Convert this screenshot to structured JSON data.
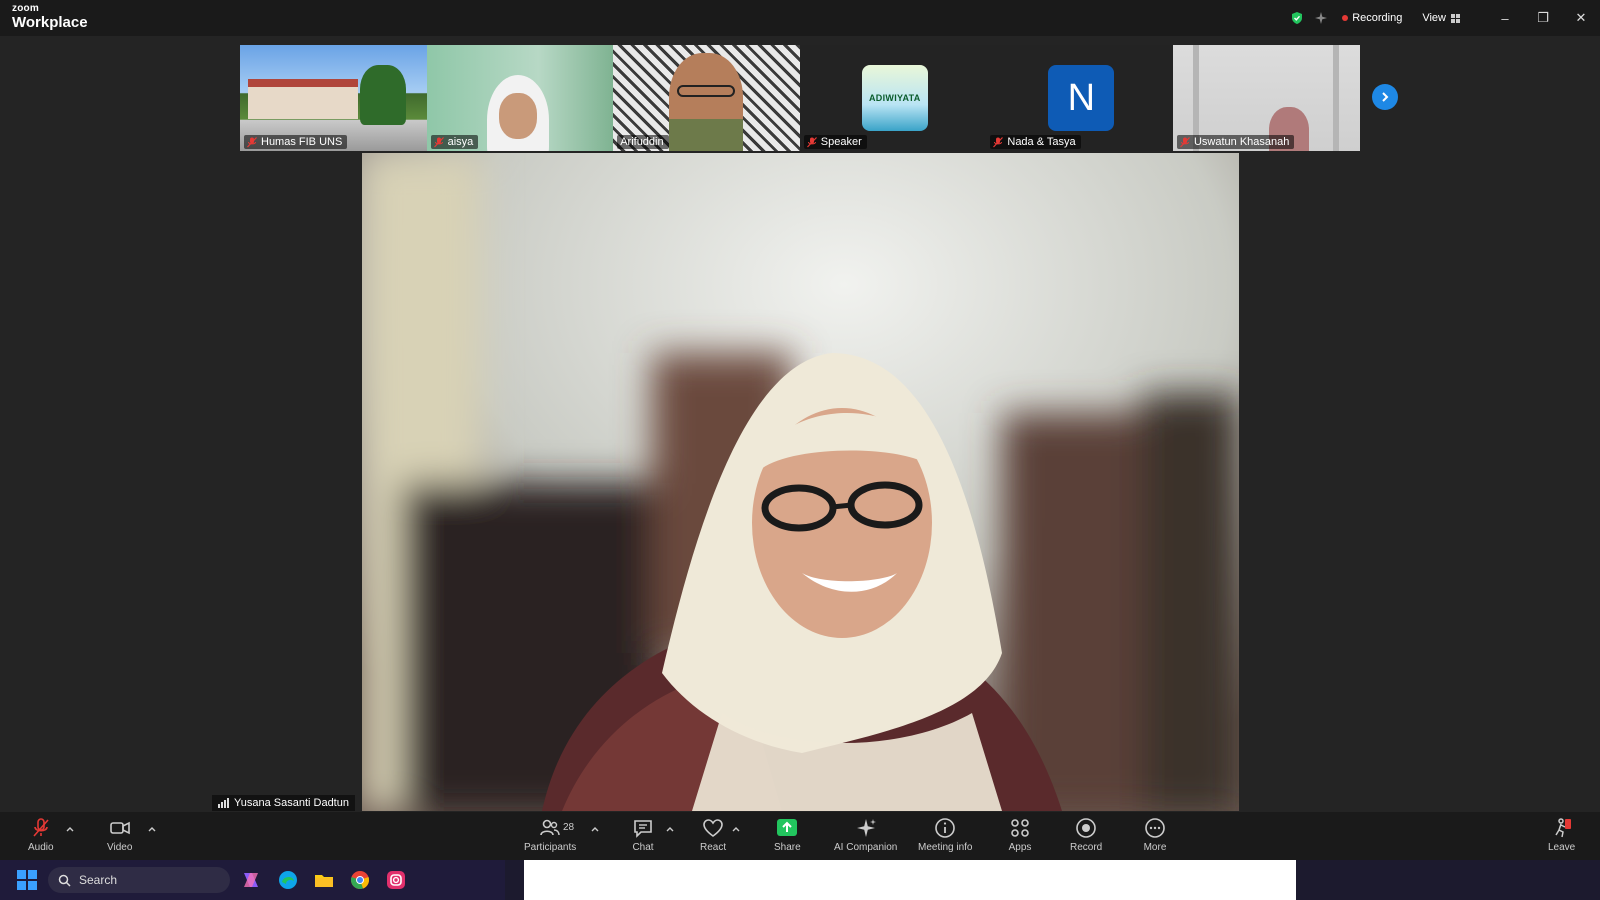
{
  "titlebar": {
    "brand_small": "zoom",
    "brand_big": "Workplace",
    "recording_label": "Recording",
    "view_label": "View"
  },
  "participants_strip": [
    {
      "name": "Humas FIB UNS",
      "muted": true,
      "type": "video"
    },
    {
      "name": "aisya",
      "muted": true,
      "type": "video"
    },
    {
      "name": "Arifuddin",
      "muted": false,
      "type": "video"
    },
    {
      "name": "Speaker",
      "muted": true,
      "type": "avatar-image",
      "avatar_text": "ADIWIYATA"
    },
    {
      "name": "Nada & Tasya",
      "muted": true,
      "type": "initial",
      "initial": "N"
    },
    {
      "name": "Uswatun Khasanah",
      "muted": true,
      "type": "video"
    }
  ],
  "main": {
    "speaker_name": "Yusana Sasanti Dadtun"
  },
  "toolbar": {
    "audio": "Audio",
    "video": "Video",
    "participants": "Participants",
    "participants_count": "28",
    "chat": "Chat",
    "react": "React",
    "share": "Share",
    "ai_companion": "AI Companion",
    "meeting_info": "Meeting info",
    "apps": "Apps",
    "record": "Record",
    "more": "More",
    "leave": "Leave"
  },
  "taskbar": {
    "search_placeholder": "Search"
  },
  "colors": {
    "recording_dot": "#e53935",
    "share_green": "#22c55e",
    "accent_blue": "#1e88e5",
    "leave_red": "#e53935"
  }
}
